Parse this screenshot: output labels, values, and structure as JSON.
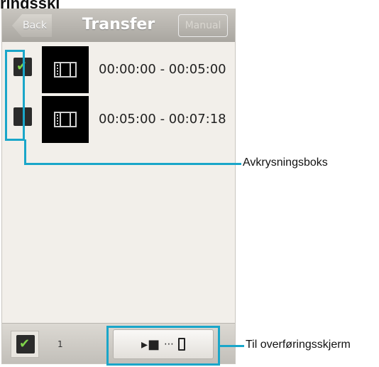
{
  "top_clip_text": "ringsskj",
  "nav": {
    "back_label": "Back",
    "title": "Transfer",
    "manual_label": "Manual"
  },
  "rows": [
    {
      "checked": true,
      "time": "00:00:00 - 00:05:00"
    },
    {
      "checked": false,
      "time": "00:05:00 - 00:07:18"
    }
  ],
  "bottom": {
    "select_all_checked": true,
    "count": "1",
    "camera_glyph": "▸■",
    "dots": "⋯"
  },
  "annotations": {
    "checkbox_label": "Avkrysningsboks",
    "transfer_label": "Til overføringsskjerm"
  },
  "colors": {
    "callout": "#1aa6c9",
    "checkmark": "#7fd34a"
  },
  "icons": {
    "film": "film-icon",
    "camera": "video-camera-icon",
    "phone": "phone-icon",
    "check": "checkmark-icon"
  }
}
